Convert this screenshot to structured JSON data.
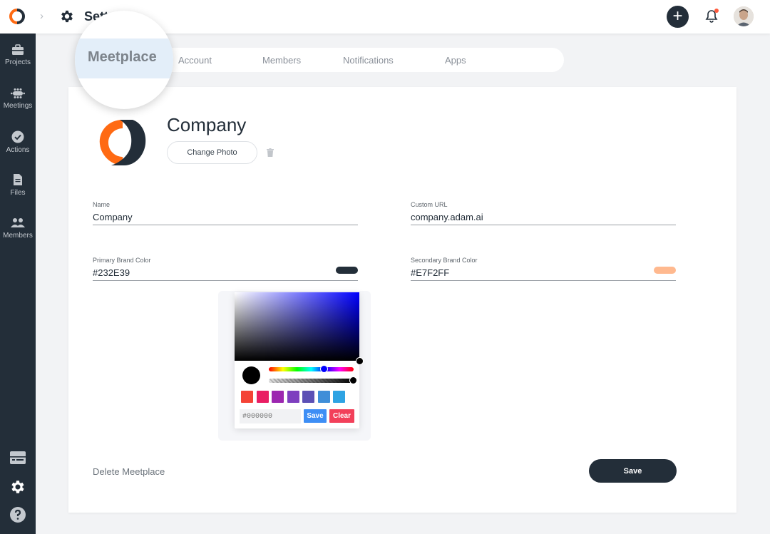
{
  "header": {
    "breadcrumb_separator": "›",
    "title": "Sett",
    "add_icon": "plus-icon",
    "notification_icon": "bell-icon",
    "notification_dot_color": "#ff5a3c"
  },
  "sidebar": {
    "items": [
      {
        "label": "Projects",
        "icon": "briefcase-icon"
      },
      {
        "label": "Meetings",
        "icon": "meeting-table-icon"
      },
      {
        "label": "Actions",
        "icon": "check-circle-icon"
      },
      {
        "label": "Files",
        "icon": "file-icon"
      },
      {
        "label": "Members",
        "icon": "people-icon"
      }
    ],
    "bottom_icons": [
      "keyboard-icon",
      "gear-icon",
      "help-icon"
    ]
  },
  "tabs": [
    {
      "label": "Meetplace",
      "active": true
    },
    {
      "label": "Account"
    },
    {
      "label": "Members"
    },
    {
      "label": "Notifications"
    },
    {
      "label": "Apps"
    }
  ],
  "company": {
    "name": "Company",
    "change_photo_label": "Change Photo"
  },
  "form": {
    "name_label": "Name",
    "name_value": "Company",
    "custom_url_label": "Custom URL",
    "custom_url_value": "company.adam.ai",
    "primary_color_label": "Primary Brand Color",
    "primary_color_value": "#232E39",
    "primary_swatch": "#232E39",
    "secondary_color_label": "Secondary Brand Color",
    "secondary_color_value": "#E7F2FF",
    "secondary_swatch": "#FFB98F"
  },
  "color_picker": {
    "hex_placeholder": "#000000",
    "save_label": "Save",
    "clear_label": "Clear",
    "presets": [
      "#f44336",
      "#e91e63",
      "#9c27b0",
      "#7e3fbf",
      "#5c50b5",
      "#3f8ed8",
      "#2ea3e3"
    ]
  },
  "footer": {
    "delete_label": "Delete Meetplace",
    "save_label": "Save"
  }
}
